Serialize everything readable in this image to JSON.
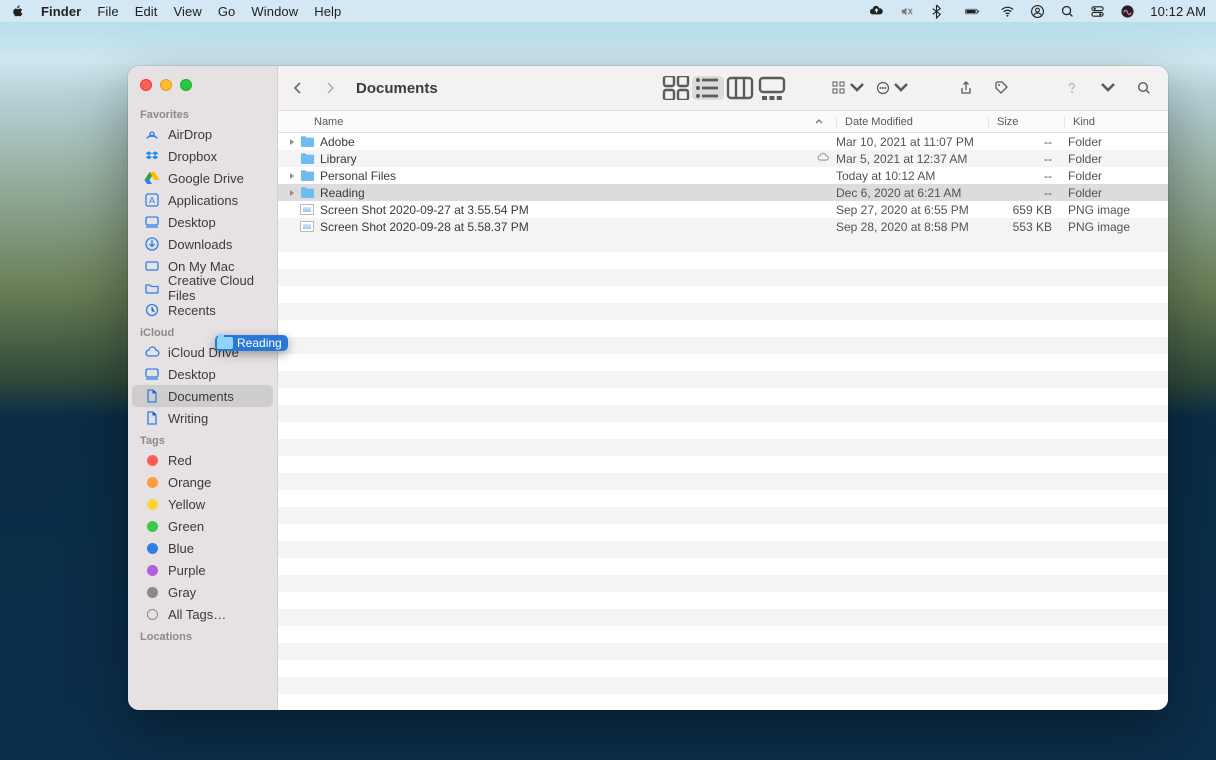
{
  "menubar": {
    "app": "Finder",
    "items": [
      "File",
      "Edit",
      "View",
      "Go",
      "Window",
      "Help"
    ],
    "clock": "10:12 AM"
  },
  "window": {
    "title": "Documents"
  },
  "sidebar": {
    "favorites_label": "Favorites",
    "favorites": [
      {
        "icon": "airdrop",
        "label": "AirDrop"
      },
      {
        "icon": "dropbox",
        "label": "Dropbox"
      },
      {
        "icon": "gdrive",
        "label": "Google Drive"
      },
      {
        "icon": "apps",
        "label": "Applications"
      },
      {
        "icon": "desktop",
        "label": "Desktop"
      },
      {
        "icon": "downloads",
        "label": "Downloads"
      },
      {
        "icon": "mac",
        "label": "On My Mac"
      },
      {
        "icon": "folder",
        "label": "Creative Cloud Files"
      },
      {
        "icon": "recents",
        "label": "Recents"
      }
    ],
    "icloud_label": "iCloud",
    "icloud": [
      {
        "icon": "cloud",
        "label": "iCloud Drive"
      },
      {
        "icon": "desktop",
        "label": "Desktop"
      },
      {
        "icon": "doc",
        "label": "Documents",
        "selected": true
      },
      {
        "icon": "doc",
        "label": "Writing"
      }
    ],
    "tags_label": "Tags",
    "tags": [
      {
        "color": "#ff5b55",
        "label": "Red"
      },
      {
        "color": "#ff9d3b",
        "label": "Orange"
      },
      {
        "color": "#ffd23a",
        "label": "Yellow"
      },
      {
        "color": "#3fc84a",
        "label": "Green"
      },
      {
        "color": "#2f7fe6",
        "label": "Blue"
      },
      {
        "color": "#b25ee0",
        "label": "Purple"
      },
      {
        "color": "#8a8a8a",
        "label": "Gray"
      }
    ],
    "all_tags_label": "All Tags…",
    "locations_label": "Locations",
    "drag_item": "Reading"
  },
  "columns": {
    "name": "Name",
    "date": "Date Modified",
    "size": "Size",
    "kind": "Kind"
  },
  "files": [
    {
      "type": "folder",
      "disclosure": true,
      "name": "Adobe",
      "date": "Mar 10, 2021 at 11:07 PM",
      "size": "--",
      "kind": "Folder",
      "cloud": false
    },
    {
      "type": "folder",
      "disclosure": false,
      "name": "Library",
      "date": "Mar 5, 2021 at 12:37 AM",
      "size": "--",
      "kind": "Folder",
      "cloud": true
    },
    {
      "type": "folder",
      "disclosure": true,
      "name": "Personal Files",
      "date": "Today at 10:12 AM",
      "size": "--",
      "kind": "Folder",
      "cloud": false
    },
    {
      "type": "folder",
      "disclosure": true,
      "name": "Reading",
      "date": "Dec 6, 2020 at 6:21 AM",
      "size": "--",
      "kind": "Folder",
      "cloud": false,
      "selected": true
    },
    {
      "type": "image",
      "disclosure": false,
      "name": "Screen Shot 2020-09-27 at 3.55.54 PM",
      "date": "Sep 27, 2020 at 6:55 PM",
      "size": "659 KB",
      "kind": "PNG image",
      "cloud": false
    },
    {
      "type": "image",
      "disclosure": false,
      "name": "Screen Shot 2020-09-28 at 5.58.37 PM",
      "date": "Sep 28, 2020 at 8:58 PM",
      "size": "553 KB",
      "kind": "PNG image",
      "cloud": false
    }
  ]
}
